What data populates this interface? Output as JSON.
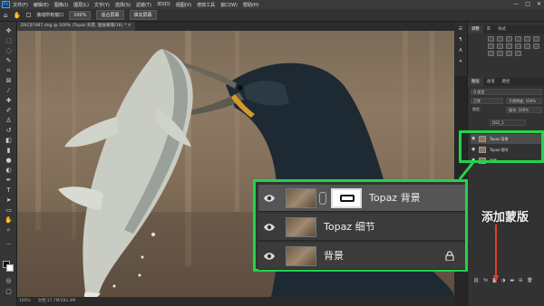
{
  "menubar": {
    "app_icon": "Ps",
    "items": [
      "文件(F)",
      "编辑(E)",
      "图像(I)",
      "图层(L)",
      "文字(Y)",
      "选择(S)",
      "滤镜(T)",
      "3D(D)",
      "视图(V)",
      "增效工具",
      "窗口(W)",
      "帮助(H)"
    ],
    "win_controls": [
      "—",
      "□",
      "✕"
    ]
  },
  "optionsbar": {
    "hand_tool_icon": "hand-icon",
    "scroll_all_label": "滚动所有窗口",
    "zoom_label": "100%",
    "fit_screen_label": "适合屏幕",
    "fill_screen_label": "填充屏幕"
  },
  "document": {
    "tab_title": "DSC07487.dng @ 100% (Topaz 背景, 图层蒙版/16) *"
  },
  "statusbar": {
    "zoom": "100%",
    "doc_info": "文档:17.7M/281.4M"
  },
  "rightpanel": {
    "top_tabs": [
      "调整",
      "库",
      "样式"
    ],
    "layers_tabs": [
      "图层",
      "通道",
      "路径"
    ],
    "filter_label": "Q 类型",
    "blend_mode": "正常",
    "opacity_label": "不透明度: 100%",
    "lock_label": "锁定:",
    "fill_label": "填充: 100%",
    "group_name": "DSC_1",
    "mini_layers": [
      {
        "name": "Topaz 背景",
        "selected": true
      },
      {
        "name": "Topaz 细节",
        "selected": false
      },
      {
        "name": "背景",
        "selected": false
      }
    ]
  },
  "callout": {
    "layers": [
      {
        "name": "Topaz 背景",
        "selected": true,
        "has_mask": true,
        "locked": false
      },
      {
        "name": "Topaz 细节",
        "selected": false,
        "has_mask": false,
        "locked": false
      },
      {
        "name": "背景",
        "selected": false,
        "has_mask": false,
        "locked": true
      }
    ]
  },
  "annotation": {
    "text": "添加蒙版",
    "arrow_color": "#e0402a",
    "highlight_color": "#22d44a"
  }
}
